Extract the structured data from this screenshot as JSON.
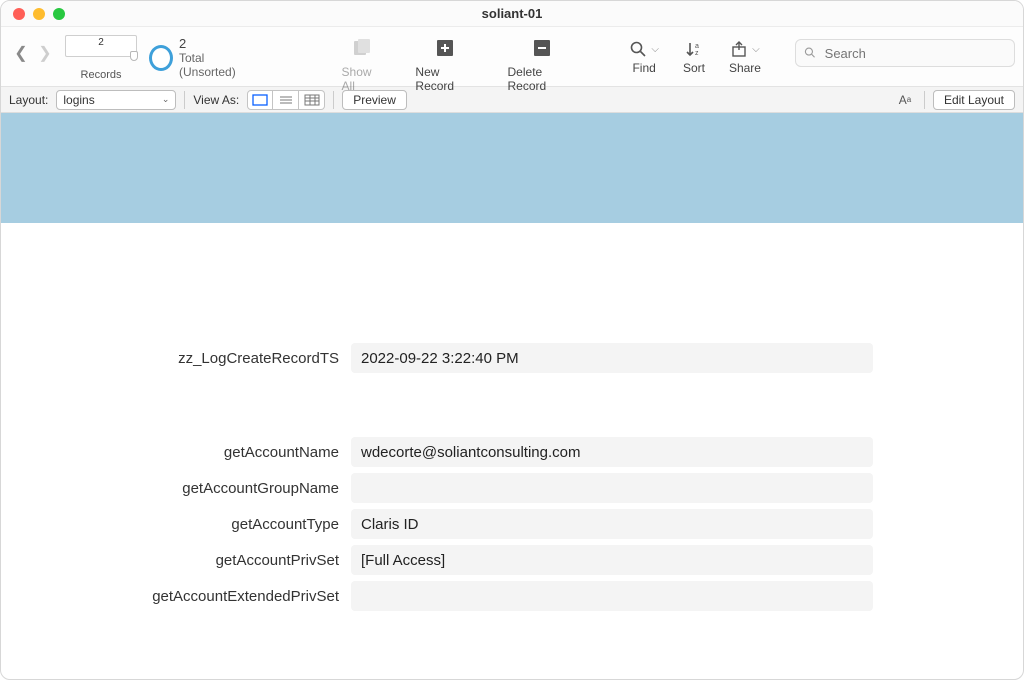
{
  "window": {
    "title": "soliant-01"
  },
  "toolbar": {
    "slider_value": "2",
    "records_label": "Records",
    "total_count": "2",
    "total_label": "Total (Unsorted)",
    "show_all": "Show All",
    "new_record": "New Record",
    "delete_record": "Delete Record",
    "find": "Find",
    "sort": "Sort",
    "share": "Share",
    "search_placeholder": "Search"
  },
  "layoutbar": {
    "layout_label": "Layout:",
    "layout_name": "logins",
    "view_as": "View As:",
    "preview": "Preview",
    "edit_layout": "Edit Layout"
  },
  "fields": {
    "rows": [
      {
        "label": "zz_LogCreateRecordTS",
        "value": "2022-09-22 3:22:40 PM"
      }
    ],
    "rows2": [
      {
        "label": "getAccountName",
        "value": "wdecorte@soliantconsulting.com"
      },
      {
        "label": "getAccountGroupName",
        "value": ""
      },
      {
        "label": "getAccountType",
        "value": "Claris ID"
      },
      {
        "label": "getAccountPrivSet",
        "value": "[Full Access]"
      },
      {
        "label": "getAccountExtendedPrivSet",
        "value": ""
      }
    ]
  }
}
